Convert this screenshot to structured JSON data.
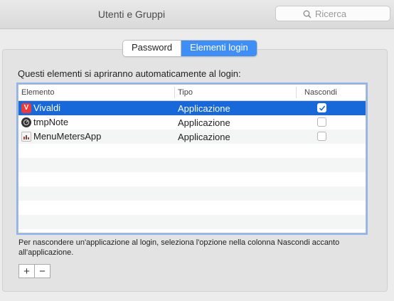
{
  "window": {
    "title": "Utenti e Gruppi"
  },
  "search": {
    "placeholder": "Ricerca",
    "icon": "search-icon"
  },
  "tabs": [
    {
      "label": "Password",
      "active": false
    },
    {
      "label": "Elementi login",
      "active": true
    }
  ],
  "heading": "Questi elementi si apriranno automaticamente al login:",
  "table": {
    "columns": [
      "Elemento",
      "Tipo",
      "Nascondi"
    ],
    "rows": [
      {
        "name": "Vivaldi",
        "type": "Applicazione",
        "hide": true,
        "selected": true,
        "icon": "vivaldi-icon"
      },
      {
        "name": "tmpNote",
        "type": "Applicazione",
        "hide": false,
        "selected": false,
        "icon": "tmpnote-icon"
      },
      {
        "name": "MenuMetersApp",
        "type": "Applicazione",
        "hide": false,
        "selected": false,
        "icon": "menumeters-icon"
      }
    ]
  },
  "help_text": "Per nascondere un'applicazione al login, seleziona l'opzione nella colonna Nascondi accanto all'applicazione.",
  "buttons": {
    "add": "+",
    "remove": "−"
  },
  "colors": {
    "accent": "#3e8ef7",
    "selection": "#1768d8"
  }
}
